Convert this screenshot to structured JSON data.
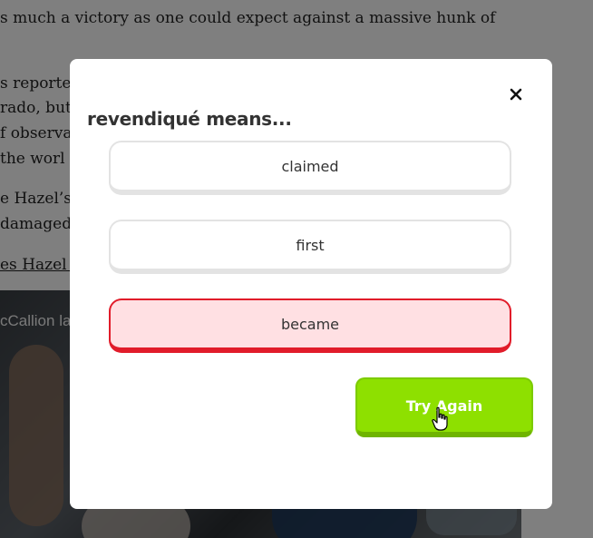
{
  "article": {
    "lines": [
      "s much a victory as one could expect against a massive hunk of",
      "s reporte",
      "rado, but",
      "f observat",
      " the worl",
      "e Hazel’s",
      "damaged",
      "es Hazel M"
    ],
    "video_caption": "cCallion la"
  },
  "quiz": {
    "prompt": "revendiqué means...",
    "options": [
      {
        "label": "claimed",
        "state": "default"
      },
      {
        "label": "first",
        "state": "default"
      },
      {
        "label": "became",
        "state": "incorrect"
      }
    ],
    "try_again_label": "Try Again"
  },
  "icons": {
    "close": "close-icon",
    "cursor": "hand-pointer-icon"
  },
  "colors": {
    "incorrect_bg": "#ffe0e3",
    "incorrect_border": "#e11c2a",
    "accent_green": "#8ee000"
  }
}
